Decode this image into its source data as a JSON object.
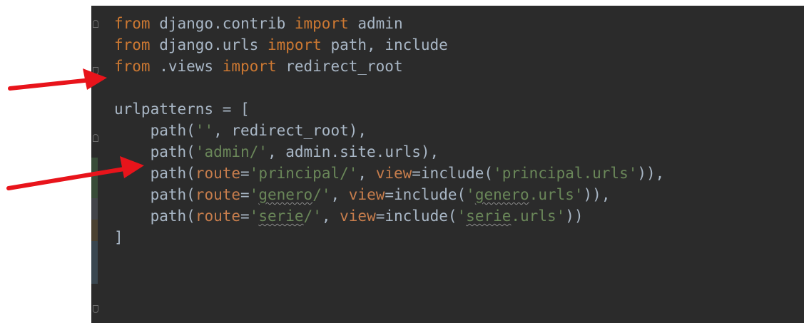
{
  "code": {
    "lines": [
      {
        "tokens": [
          {
            "t": "from",
            "c": "kw"
          },
          {
            "t": " django.contrib ",
            "c": "plain"
          },
          {
            "t": "import",
            "c": "kw"
          },
          {
            "t": " admin",
            "c": "plain"
          }
        ]
      },
      {
        "tokens": [
          {
            "t": "from",
            "c": "kw"
          },
          {
            "t": " django.urls ",
            "c": "plain"
          },
          {
            "t": "import",
            "c": "kw"
          },
          {
            "t": " path, include",
            "c": "plain"
          }
        ]
      },
      {
        "tokens": [
          {
            "t": "from",
            "c": "kw"
          },
          {
            "t": " .views ",
            "c": "plain"
          },
          {
            "t": "import",
            "c": "kw"
          },
          {
            "t": " redirect_root",
            "c": "plain"
          }
        ]
      },
      {
        "tokens": []
      },
      {
        "tokens": [
          {
            "t": "urlpatterns = [",
            "c": "plain"
          }
        ]
      },
      {
        "tokens": [
          {
            "t": "    path(",
            "c": "plain"
          },
          {
            "t": "''",
            "c": "str"
          },
          {
            "t": ", redirect_root),",
            "c": "plain"
          }
        ]
      },
      {
        "tokens": [
          {
            "t": "    path(",
            "c": "plain"
          },
          {
            "t": "'admin/'",
            "c": "str"
          },
          {
            "t": ", admin.site.urls),",
            "c": "plain"
          }
        ]
      },
      {
        "tokens": [
          {
            "t": "    path(",
            "c": "plain"
          },
          {
            "t": "route",
            "c": "param"
          },
          {
            "t": "=",
            "c": "plain"
          },
          {
            "t": "'principal/'",
            "c": "str"
          },
          {
            "t": ", ",
            "c": "plain"
          },
          {
            "t": "view",
            "c": "param"
          },
          {
            "t": "=include(",
            "c": "plain"
          },
          {
            "t": "'principal.urls'",
            "c": "str"
          },
          {
            "t": ")),",
            "c": "plain"
          }
        ]
      },
      {
        "tokens": [
          {
            "t": "    path(",
            "c": "plain"
          },
          {
            "t": "route",
            "c": "param"
          },
          {
            "t": "=",
            "c": "plain"
          },
          {
            "t": "'",
            "c": "str"
          },
          {
            "t": "genero",
            "c": "str squig"
          },
          {
            "t": "/'",
            "c": "str"
          },
          {
            "t": ", ",
            "c": "plain"
          },
          {
            "t": "view",
            "c": "param"
          },
          {
            "t": "=include(",
            "c": "plain"
          },
          {
            "t": "'",
            "c": "str"
          },
          {
            "t": "genero",
            "c": "str squig"
          },
          {
            "t": ".urls'",
            "c": "str"
          },
          {
            "t": ")),",
            "c": "plain"
          }
        ]
      },
      {
        "tokens": [
          {
            "t": "    path(",
            "c": "plain"
          },
          {
            "t": "route",
            "c": "param"
          },
          {
            "t": "=",
            "c": "plain"
          },
          {
            "t": "'",
            "c": "str"
          },
          {
            "t": "serie",
            "c": "str squig"
          },
          {
            "t": "/'",
            "c": "str"
          },
          {
            "t": ", ",
            "c": "plain"
          },
          {
            "t": "view",
            "c": "param"
          },
          {
            "t": "=include(",
            "c": "plain"
          },
          {
            "t": "'",
            "c": "str"
          },
          {
            "t": "serie",
            "c": "str squig"
          },
          {
            "t": ".urls'",
            "c": "str"
          },
          {
            "t": "))",
            "c": "plain"
          }
        ]
      },
      {
        "tokens": [
          {
            "t": "]",
            "c": "plain"
          }
        ]
      }
    ]
  },
  "colors": {
    "editor_bg": "#2b2b2b",
    "keyword": "#cc7832",
    "string": "#6a8759",
    "named_param": "#c77d4c",
    "plain": "#a9b7c6",
    "annotation_arrow": "#e8141b",
    "gutter_added": "#384c38",
    "gutter_modified": "#43454a",
    "gutter_changed": "#4b4231"
  }
}
